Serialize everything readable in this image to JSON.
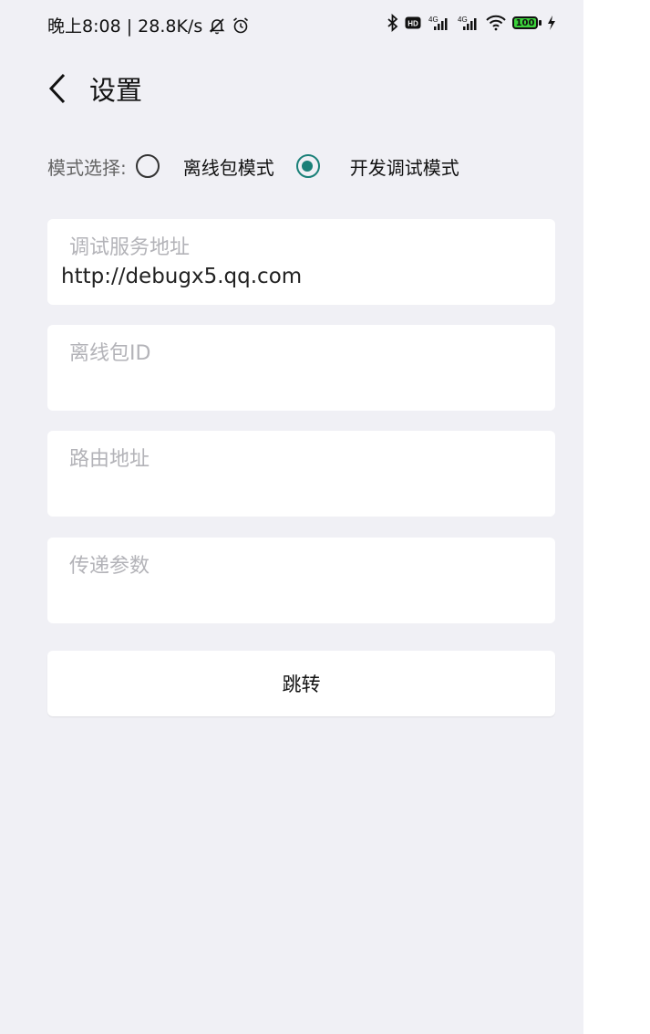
{
  "status_bar": {
    "time_speed": "晚上8:08 | 28.8K/s",
    "battery_level": "100",
    "network_labels": [
      "4G",
      "4G"
    ],
    "hd_label": "HD"
  },
  "header": {
    "title": "设置"
  },
  "mode_select": {
    "label": "模式选择:",
    "options": [
      {
        "label": "离线包模式",
        "checked": false
      },
      {
        "label": "开发调试模式",
        "checked": true
      }
    ]
  },
  "fields": [
    {
      "label": "调试服务地址",
      "value": "http://debugx5.qq.com"
    },
    {
      "label": "离线包ID",
      "value": ""
    },
    {
      "label": "路由地址",
      "value": ""
    },
    {
      "label": "传递参数",
      "value": ""
    }
  ],
  "jump_button": {
    "label": "跳转"
  },
  "colors": {
    "accent": "#1a8078",
    "background": "#f0f0f5",
    "card": "#ffffff",
    "placeholder": "#b3b3b8"
  }
}
